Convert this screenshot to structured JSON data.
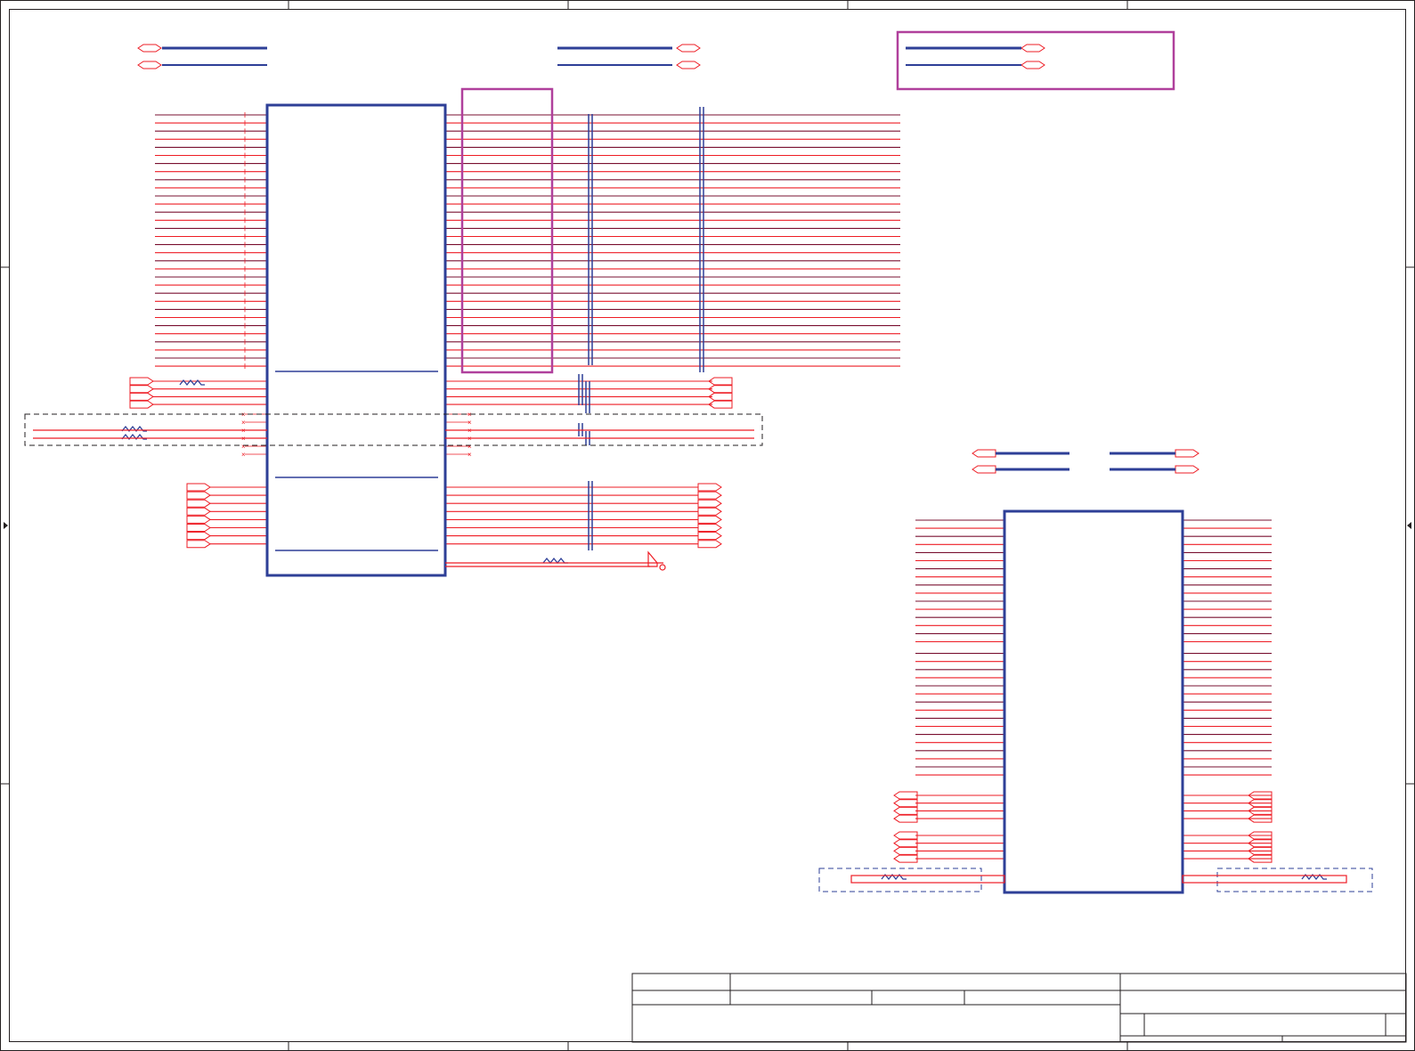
{
  "colors": {
    "background": "#ffffff",
    "frame": "#231f20",
    "wire_red": "#ee1c24",
    "wire_dark": "#7a1030",
    "component_blue": "#2e3f97",
    "highlight_magenta": "#b0409c",
    "dashed_group": "#231f20",
    "dashed_group_blue": "#2e3f97"
  },
  "schematic": {
    "ic_u1": {
      "left_pins": 32,
      "right_pins": 32,
      "internal_divisions": 3
    },
    "ic_u2": {
      "left_pins": 32,
      "right_pins": 32
    },
    "title_block": {
      "cells": []
    }
  }
}
